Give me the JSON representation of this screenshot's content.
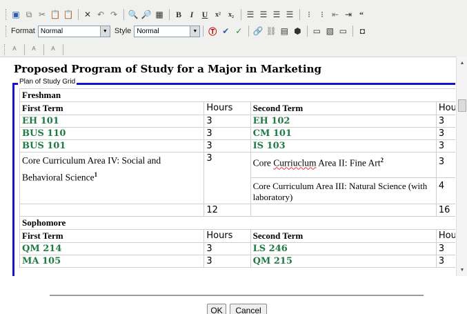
{
  "toolbar": {
    "format_label": "Format",
    "format_value": "Normal",
    "style_label": "Style",
    "style_value": "Normal",
    "bold_label": "B",
    "italic_label": "I",
    "underline_label": "U",
    "superscript_label": "x²",
    "subscript_label": "x₂"
  },
  "document": {
    "title": "Proposed Program of Study for a Major in Marketing",
    "legend": "Plan of Study Grid",
    "freshman": {
      "section": "Freshman",
      "first_term_header": "First Term",
      "hours_header": "Hours",
      "second_term_header": "Second Term",
      "hours_header_2": "Hours",
      "rows": [
        {
          "c1": "EH 101",
          "h1": "3",
          "c2": "EH 102",
          "h2": "3"
        },
        {
          "c1": "BUS 110",
          "h1": "3",
          "c2": "CM 101",
          "h2": "3"
        },
        {
          "c1": "BUS 101",
          "h1": "3",
          "c2": "IS 103",
          "h2": "3"
        }
      ],
      "core4": "Core Curriculum Area IV: Social and Behavioral Science",
      "core4_sup": "1",
      "core4_hours": "3",
      "core2_prefix": "Core ",
      "core2_misspelled": "Curriuclum",
      "core2_suffix": " Area II: Fine Art",
      "core2_sup": "2",
      "core2_hours": "3",
      "core3": "Core Curriculum Area III: Natural Science (with laboratory)",
      "core3_hours": "4",
      "total_first": "12",
      "total_second": "16"
    },
    "sophomore": {
      "section": "Sophomore",
      "first_term_header": "First Term",
      "hours_header": "Hours",
      "second_term_header": "Second Term",
      "hours_header_2": "Hours",
      "rows": [
        {
          "c1": "QM 214",
          "h1": "3",
          "c2": "LS 246",
          "h2": "3"
        },
        {
          "c1": "MA 105",
          "h1": "3",
          "c2": "QM 215",
          "h2": "3"
        }
      ]
    }
  },
  "footer": {
    "ok_label": "OK",
    "cancel_label": "Cancel"
  }
}
